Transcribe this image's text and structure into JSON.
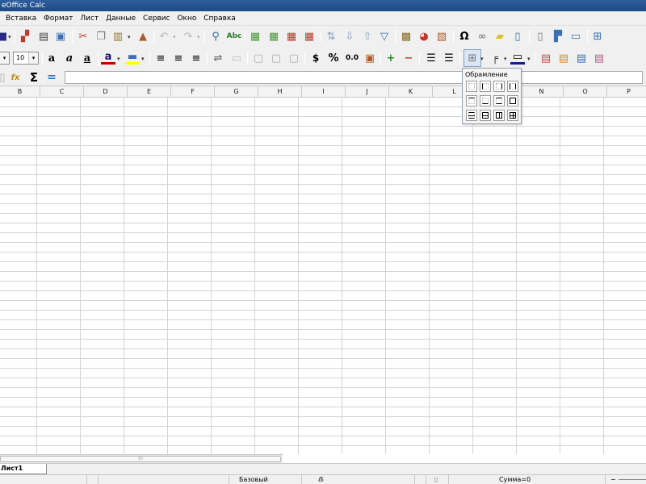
{
  "window": {
    "title": "eOffice Calc"
  },
  "menu": [
    "Вставка",
    "Формат",
    "Лист",
    "Данные",
    "Сервис",
    "Окно",
    "Справка"
  ],
  "toolbar2": {
    "font_size": "10",
    "bold_icon_text": "a",
    "italic_icon_text": "a",
    "underline_icon_text": "a",
    "currency": "$",
    "percent": "%",
    "decimal": "0.0"
  },
  "formula_bar": {
    "sum_symbol": "Σ",
    "equals_symbol": "=",
    "value": ""
  },
  "columns": [
    "B",
    "C",
    "D",
    "E",
    "F",
    "G",
    "H",
    "I",
    "J",
    "K",
    "L",
    "M",
    "N",
    "O",
    "P"
  ],
  "borders_popup": {
    "title": "Обрамление"
  },
  "sheets": [
    {
      "name": "Лист1"
    }
  ],
  "statusbar": {
    "style": "Базовый",
    "sum": "Сумма=0"
  },
  "colors": {
    "titlebar": "#2f5f9e",
    "chrome": "#f0f0f0",
    "grid": "#d4d4d4"
  }
}
